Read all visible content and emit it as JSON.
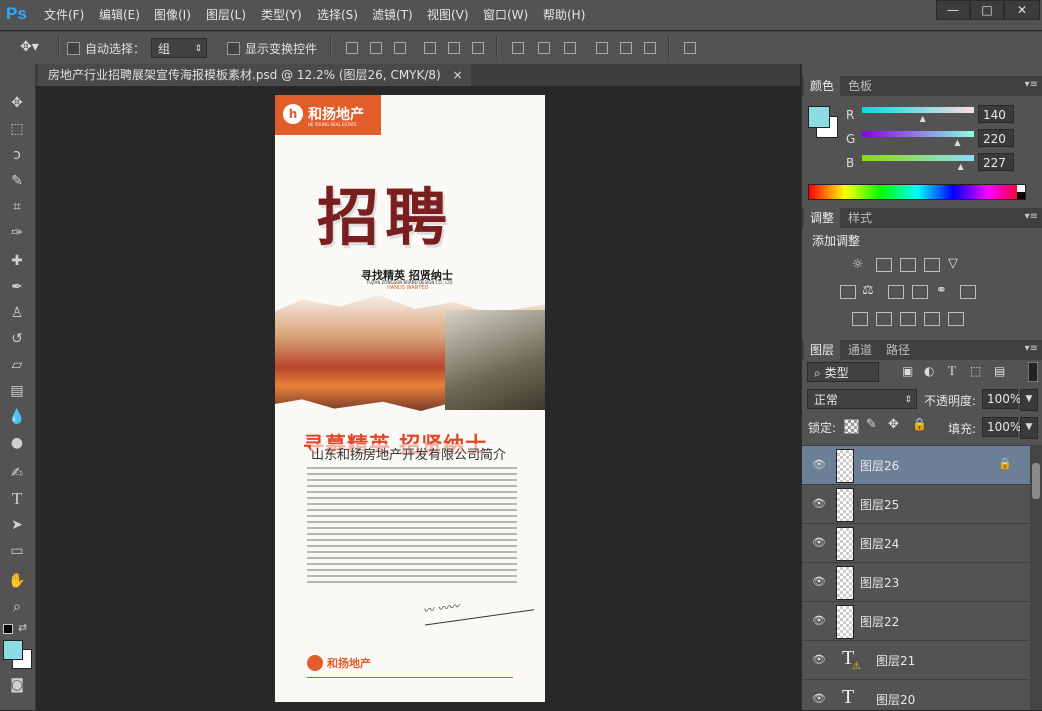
{
  "app": {
    "logo": "Ps"
  },
  "menu": [
    "文件(F)",
    "编辑(E)",
    "图像(I)",
    "图层(L)",
    "类型(Y)",
    "选择(S)",
    "滤镜(T)",
    "视图(V)",
    "窗口(W)",
    "帮助(H)"
  ],
  "window_controls": {
    "minimize": "—",
    "restore": "□",
    "close": "✕"
  },
  "options": {
    "auto_select_label": "自动选择：",
    "auto_select_value": "组",
    "show_transform_label": "显示变换控件"
  },
  "document": {
    "tab_title": "房地产行业招聘展架宣传海报模板素材.psd @ 12.2% (图层26, CMYK/8)",
    "close": "×"
  },
  "poster": {
    "brand_cn": "和扬地产",
    "brand_en": "HE YOUNG REAL ESTATE",
    "headline": "招聘",
    "subhead": "寻找精英 招贤纳士",
    "company_en": "FUJIAN ZONGSON BRAND DESIGN CO., LTD",
    "hands_wanted": "HANDS WANTED",
    "big_slogan": "寻募精英 招贤纳士",
    "intro_title": "山东和扬房地产开发有限公司简介",
    "footer_brand": "和扬地产"
  },
  "color_panel": {
    "tabs": [
      "颜色",
      "色板"
    ],
    "r_label": "R",
    "r_value": "140",
    "g_label": "G",
    "g_value": "220",
    "b_label": "B",
    "b_value": "227",
    "r_fraction": 0.55,
    "g_fraction": 0.86,
    "b_fraction": 0.89,
    "foreground": "#8cdce3"
  },
  "adjust_panel": {
    "tabs": [
      "调整",
      "样式"
    ],
    "title": "添加调整"
  },
  "layers_panel": {
    "tabs": [
      "图层",
      "通道",
      "路径"
    ],
    "filter_label": "类型",
    "blend_mode": "正常",
    "opacity_label": "不透明度:",
    "opacity_value": "100%",
    "lock_label": "锁定:",
    "fill_label": "填充:",
    "fill_value": "100%",
    "layers": [
      {
        "name": "图层26",
        "type": "pixel",
        "selected": true
      },
      {
        "name": "图层25",
        "type": "pixel",
        "selected": false
      },
      {
        "name": "图层24",
        "type": "pixel",
        "selected": false
      },
      {
        "name": "图层23",
        "type": "pixel",
        "selected": false
      },
      {
        "name": "图层22",
        "type": "pixel",
        "selected": false
      },
      {
        "name": "图层21",
        "type": "text",
        "selected": false
      },
      {
        "name": "图层20",
        "type": "text",
        "selected": false
      }
    ]
  }
}
